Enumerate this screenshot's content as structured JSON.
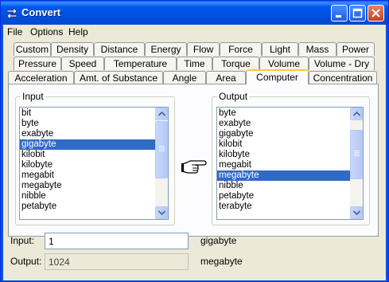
{
  "window": {
    "title": "Convert"
  },
  "menu": [
    "File",
    "Options",
    "Help"
  ],
  "tabs": {
    "row1": [
      "Custom",
      "Density",
      "Distance",
      "Energy",
      "Flow",
      "Force",
      "Light",
      "Mass",
      "Power"
    ],
    "row2": [
      "Pressure",
      "Speed",
      "Temperature",
      "Time",
      "Torque",
      "Volume",
      "Volume - Dry"
    ],
    "row3": [
      "Acceleration",
      "Amt. of Substance",
      "Angle",
      "Area",
      "Computer",
      "Concentration"
    ],
    "active": "Computer"
  },
  "input_group": {
    "label": "Input",
    "items": [
      "bit",
      "byte",
      "exabyte",
      "gigabyte",
      "kilobit",
      "kilobyte",
      "megabit",
      "megabyte",
      "nibble",
      "petabyte"
    ],
    "selected": "gigabyte"
  },
  "output_group": {
    "label": "Output",
    "items": [
      "byte",
      "exabyte",
      "gigabyte",
      "kilobit",
      "kilobyte",
      "megabit",
      "megabyte",
      "nibble",
      "petabyte",
      "terabyte"
    ],
    "selected": "megabyte"
  },
  "fields": {
    "input_label": "Input:",
    "input_value": "1",
    "input_unit": "gigabyte",
    "output_label": "Output:",
    "output_value": "1024",
    "output_unit": "megabyte"
  },
  "icons": {
    "pointer": "pointing-hand-icon"
  }
}
